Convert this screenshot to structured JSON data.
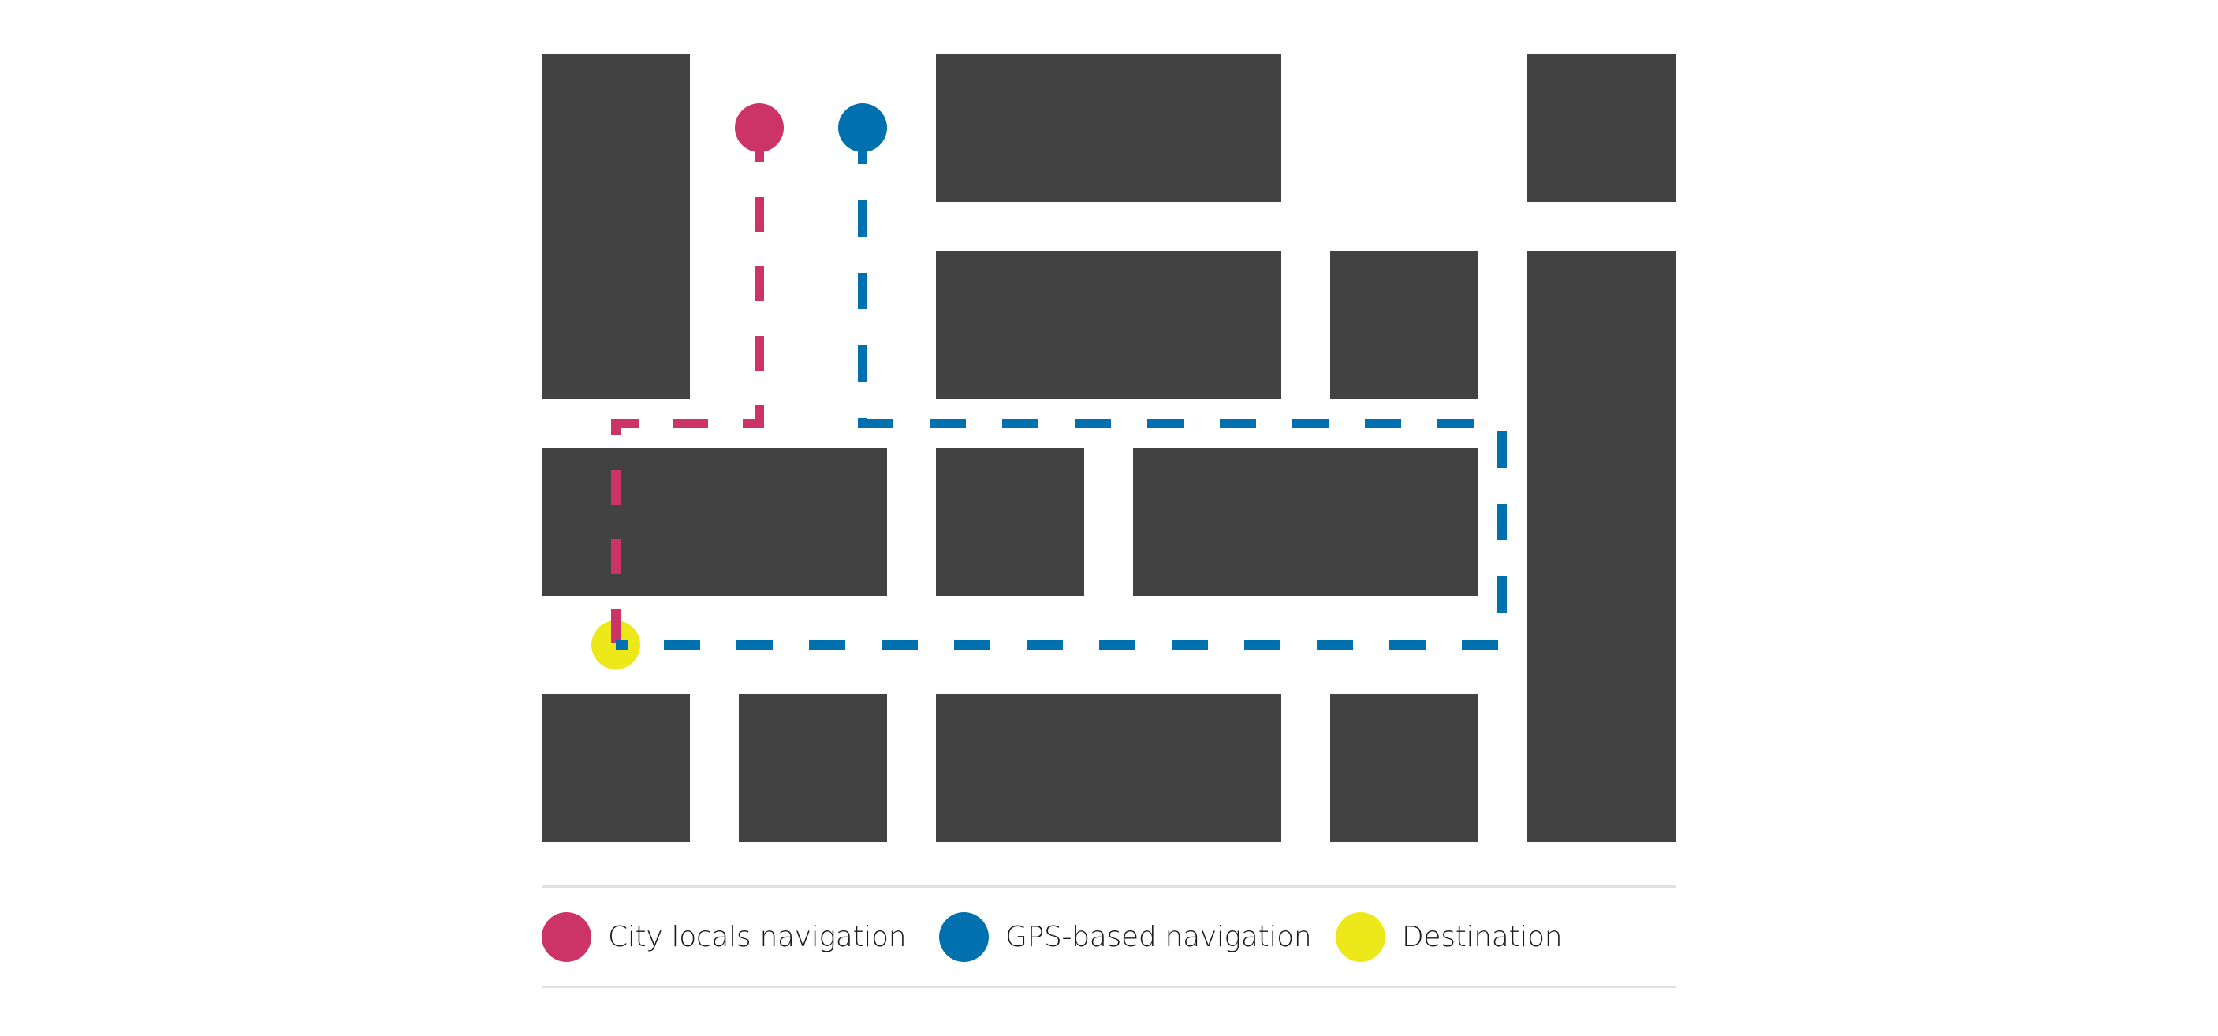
{
  "colors": {
    "block": "#424242",
    "city_locals": "#CC3366",
    "gps": "#0071AE",
    "destination": "#EDE81A",
    "rule": "#E0E0E0"
  },
  "map": {
    "grid": {
      "columns": 6,
      "rows": 4
    },
    "blocks": [
      {
        "id": "r1-c1",
        "col": 0,
        "row": 0,
        "colspan": 1,
        "rowspan": 2
      },
      {
        "id": "r1-c3",
        "col": 2,
        "row": 0,
        "colspan": 2,
        "rowspan": 1
      },
      {
        "id": "r1-c6",
        "col": 5,
        "row": 0,
        "colspan": 1,
        "rowspan": 1
      },
      {
        "id": "r2-c3",
        "col": 2,
        "row": 1,
        "colspan": 1,
        "rowspan": 1,
        "widen": true
      },
      {
        "id": "r2-c5",
        "col": 4,
        "row": 1,
        "colspan": 1,
        "rowspan": 1
      },
      {
        "id": "r2-c6",
        "col": 5,
        "row": 1,
        "colspan": 1,
        "rowspan": 3
      },
      {
        "id": "r3-c1",
        "col": 0,
        "row": 2,
        "colspan": 2,
        "rowspan": 1
      },
      {
        "id": "r3-c3",
        "col": 2,
        "row": 2,
        "colspan": 1,
        "rowspan": 1
      },
      {
        "id": "r3-c4",
        "col": 3,
        "row": 2,
        "colspan": 2,
        "rowspan": 1
      },
      {
        "id": "r4-c1",
        "col": 0,
        "row": 3,
        "colspan": 1,
        "rowspan": 1
      },
      {
        "id": "r4-c2",
        "col": 1,
        "row": 3,
        "colspan": 1,
        "rowspan": 1
      },
      {
        "id": "r4-c3",
        "col": 2,
        "row": 3,
        "colspan": 2,
        "rowspan": 1
      },
      {
        "id": "r4-c5",
        "col": 4,
        "row": 3,
        "colspan": 1,
        "rowspan": 1
      }
    ],
    "routes": [
      {
        "id": "city-locals-route",
        "legend": "city_locals",
        "color_key": "city_locals",
        "start": "city-locals-start",
        "end": "destination"
      },
      {
        "id": "gps-route",
        "legend": "gps",
        "color_key": "gps",
        "start": "gps-start",
        "end": "destination"
      }
    ],
    "markers": [
      {
        "id": "city-locals-start",
        "color_key": "city_locals"
      },
      {
        "id": "gps-start",
        "color_key": "gps"
      },
      {
        "id": "destination",
        "color_key": "destination"
      }
    ]
  },
  "legend": {
    "items": [
      {
        "key": "city_locals",
        "label": "City locals navigation"
      },
      {
        "key": "gps",
        "label": "GPS-based navigation"
      },
      {
        "key": "destination",
        "label": "Destination"
      }
    ]
  }
}
